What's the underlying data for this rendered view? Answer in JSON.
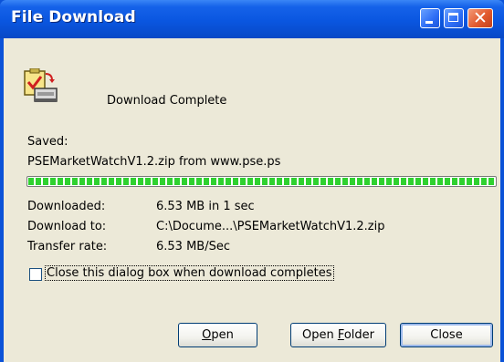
{
  "window": {
    "title": "File Download",
    "close_glyph": "✕"
  },
  "status": {
    "heading": "Download Complete"
  },
  "saved": {
    "label": "Saved:",
    "file_text": "PSEMarketWatchV1.2.zip from www.pse.ps"
  },
  "progress": {
    "percent": 100
  },
  "details": {
    "downloaded_label": "Downloaded:",
    "downloaded_value": "6.53 MB in 1 sec",
    "download_to_label": "Download to:",
    "download_to_value": "C:\\Docume...\\PSEMarketWatchV1.2.zip",
    "rate_label": "Transfer rate:",
    "rate_value": "6.53 MB/Sec"
  },
  "options": {
    "close_when_done_label": "Close this dialog box when download completes",
    "close_when_done_checked": false
  },
  "buttons": {
    "open_mnemonic": "O",
    "open_rest": "pen",
    "open_folder_pre": "Open ",
    "open_folder_mnemonic": "F",
    "open_folder_rest": "older",
    "close": "Close"
  },
  "icons": {
    "app_icon": "download-complete-icon"
  },
  "colors": {
    "titlebar": "#0a56e0",
    "client_bg": "#ece9d8",
    "progress_fill": "#2fd12f",
    "close_button": "#e25a2e"
  }
}
